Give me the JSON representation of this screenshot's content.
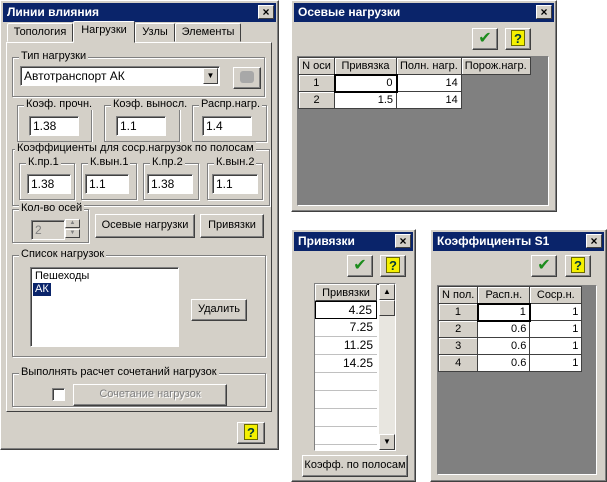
{
  "win_main": {
    "title": "Линии влияния",
    "tabs": [
      "Топология",
      "Нагрузки",
      "Узлы",
      "Элементы"
    ],
    "load_type_group": "Тип нагрузки",
    "load_type_value": "Автотранспорт АК",
    "coef_strength_label": "Коэф. прочн.",
    "coef_strength_value": "1.38",
    "coef_endurance_label": "Коэф. выносл.",
    "coef_endurance_value": "1.1",
    "distr_load_label": "Распр.нагр.",
    "distr_load_value": "1.4",
    "lane_coefs_group": "Коэффициенты для соср.нагрузок по полосам",
    "k_pr1_label": "К.пр.1",
    "k_pr1_value": "1.38",
    "k_vyn1_label": "К.вын.1",
    "k_vyn1_value": "1.1",
    "k_pr2_label": "К.пр.2",
    "k_pr2_value": "1.38",
    "k_vyn2_label": "К.вын.2",
    "k_vyn2_value": "1.1",
    "axles_group": "Кол-во осей",
    "axles_value": "2",
    "axle_loads_button": "Осевые нагрузки",
    "bindings_button": "Привязки",
    "loads_list_group": "Список нагрузок",
    "loads_list": [
      "Пешеходы",
      "АК"
    ],
    "delete_button": "Удалить",
    "combo_group": "Выполнять расчет сочетаний нагрузок",
    "combo_button": "Сочетание нагрузок",
    "help_icon": "?"
  },
  "win_axle": {
    "title": "Осевые нагрузки",
    "headers": [
      "N оси",
      "Привязка",
      "Полн. нагр.",
      "Порож.нагр."
    ],
    "rows": [
      {
        "n": "1",
        "binding": "0",
        "full": "14"
      },
      {
        "n": "2",
        "binding": "1.5",
        "full": "14"
      }
    ]
  },
  "win_bind": {
    "title": "Привязки",
    "header": "Привязки",
    "values": [
      "4.25",
      "7.25",
      "11.25",
      "14.25"
    ],
    "lane_coef_button": "Коэфф. по полосам"
  },
  "win_coef": {
    "title": "Коэффициенты S1",
    "headers": [
      "N пол.",
      "Расп.н.",
      "Соср.н."
    ],
    "rows": [
      {
        "n": "1",
        "distr": "1",
        "conc": "1"
      },
      {
        "n": "2",
        "distr": "0.6",
        "conc": "1"
      },
      {
        "n": "3",
        "distr": "0.6",
        "conc": "1"
      },
      {
        "n": "4",
        "distr": "0.6",
        "conc": "1"
      }
    ]
  },
  "icons": {
    "close": "×",
    "ok": "✔",
    "help": "?",
    "dropdown": "▼",
    "spin_up": "▲",
    "spin_down": "▼"
  }
}
